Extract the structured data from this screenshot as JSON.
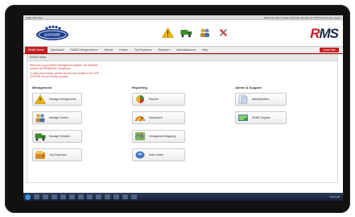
{
  "window": {
    "title": "Rigby Parmalat",
    "status": "Welcome Admin   Today is Monday   January 19, 2015   My Account   Logout"
  },
  "brand": {
    "logo": "parmalat",
    "app_logo_r": "R",
    "app_logo_rest": "MS"
  },
  "toolbar_icons": [
    "warning-icon",
    "truck-icon",
    "group-icon",
    "tools-icon"
  ],
  "nav": {
    "items": [
      "RAMS Home",
      "Dashboard",
      "RAMS Infringements ▾",
      "Vehicle",
      "Drivers",
      "Trip Expenses",
      "Reports ▾",
      "Administration ▾",
      "Help"
    ],
    "quick_label": "Quick Nav"
  },
  "panel": {
    "title": "RAMS Home",
    "welcome_line1": "Welcome to your RAMS Management System, the definitive",
    "welcome_line2": "solution for PARMALAT Compliance.",
    "welcome_line3": "To start your records, please use the links located in the TOP",
    "welcome_line4": "CENTRE of your browser window."
  },
  "sections": {
    "management": {
      "title": "Management",
      "tiles": [
        "Manage Infringements",
        "Manage Drivers",
        "Manage Vehicles",
        "Trip Expenses"
      ]
    },
    "reporting": {
      "title": "Reporting",
      "tiles": [
        "Reports",
        "Dashboard",
        "Infringement Mapping",
        "Data Cubes"
      ]
    },
    "admin": {
      "title": "Admin & Support",
      "tiles": [
        "Administration",
        "RAMS Support"
      ]
    }
  },
  "taskbar": {
    "clock": "10:24 AM"
  },
  "colors": {
    "accent": "#c31f25",
    "brand_blue": "#1f3f8f"
  }
}
